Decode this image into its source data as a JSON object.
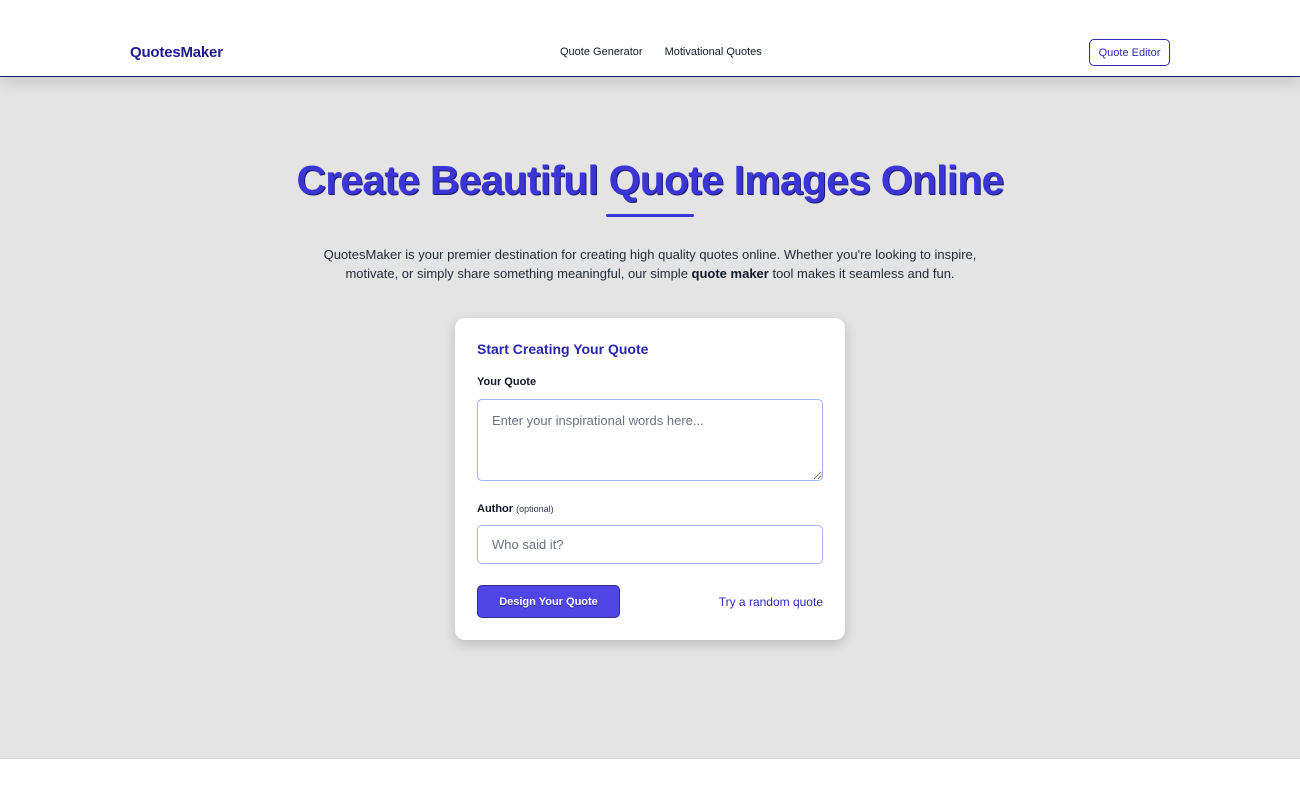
{
  "header": {
    "brand": "QuotesMaker",
    "nav": [
      "Quote Generator",
      "Motivational Quotes"
    ],
    "editor_button": "Quote Editor"
  },
  "hero": {
    "title": "Create Beautiful Quote Images Online",
    "intro_before": "QuotesMaker is your premier destination for creating high quality quotes online. Whether you're looking to inspire, motivate, or simply share something meaningful, our simple ",
    "intro_bold": "quote maker",
    "intro_after": " tool makes it seamless and fun."
  },
  "form": {
    "title": "Start Creating Your Quote",
    "quote_label": "Your Quote",
    "quote_placeholder": "Enter your inspirational words here...",
    "quote_value": "",
    "author_label": "Author",
    "author_optional": "(optional)",
    "author_placeholder": "Who said it?",
    "author_value": "",
    "submit_label": "Design Your Quote",
    "random_link": "Try a random quote"
  },
  "colors": {
    "accent": "#4f46e5",
    "brand": "#1e1b8e",
    "hero_background": "#e4e4e4"
  }
}
